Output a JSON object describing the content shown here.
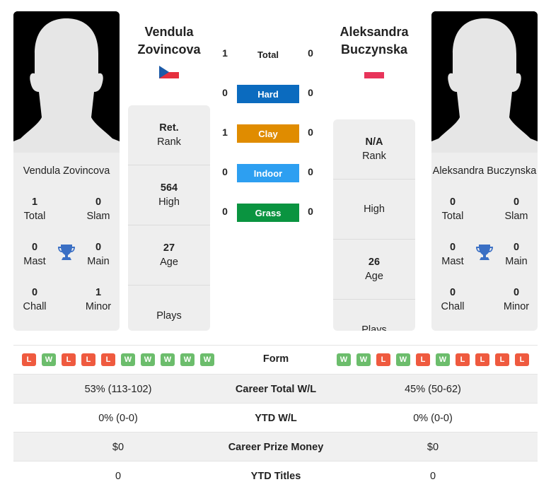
{
  "players": [
    {
      "name_line1": "Vendula",
      "name_line2": "Zovincova",
      "full_name": "Vendula Zovincova",
      "country": "Czech Republic",
      "flag_icon": "czech-flag-icon",
      "titles": {
        "total": {
          "value": "1",
          "label": "Total"
        },
        "slam": {
          "value": "0",
          "label": "Slam"
        },
        "mast": {
          "value": "0",
          "label": "Mast"
        },
        "main": {
          "value": "0",
          "label": "Main"
        },
        "chall": {
          "value": "0",
          "label": "Chall"
        },
        "minor": {
          "value": "1",
          "label": "Minor"
        }
      },
      "stats": {
        "rank": {
          "value": "Ret.",
          "label": "Rank"
        },
        "high": {
          "value": "564",
          "label": "High"
        },
        "age": {
          "value": "27",
          "label": "Age"
        },
        "plays": {
          "value": "",
          "label": "Plays"
        }
      },
      "form": [
        "L",
        "W",
        "L",
        "L",
        "L",
        "W",
        "W",
        "W",
        "W",
        "W"
      ]
    },
    {
      "name_line1": "Aleksandra",
      "name_line2": "Buczynska",
      "full_name": "Aleksandra Buczynska",
      "country": "Poland",
      "flag_icon": "poland-flag-icon",
      "titles": {
        "total": {
          "value": "0",
          "label": "Total"
        },
        "slam": {
          "value": "0",
          "label": "Slam"
        },
        "mast": {
          "value": "0",
          "label": "Mast"
        },
        "main": {
          "value": "0",
          "label": "Main"
        },
        "chall": {
          "value": "0",
          "label": "Chall"
        },
        "minor": {
          "value": "0",
          "label": "Minor"
        }
      },
      "stats": {
        "rank": {
          "value": "N/A",
          "label": "Rank"
        },
        "high": {
          "value": "",
          "label": "High"
        },
        "age": {
          "value": "26",
          "label": "Age"
        },
        "plays": {
          "value": "",
          "label": "Plays"
        }
      },
      "form": [
        "W",
        "W",
        "L",
        "W",
        "L",
        "W",
        "L",
        "L",
        "L",
        "L"
      ]
    }
  ],
  "h2h": [
    {
      "label": "Total",
      "left": "1",
      "right": "0",
      "color": ""
    },
    {
      "label": "Hard",
      "left": "0",
      "right": "0",
      "color": "#0b6bbf"
    },
    {
      "label": "Clay",
      "left": "1",
      "right": "0",
      "color": "#e08c00"
    },
    {
      "label": "Indoor",
      "left": "0",
      "right": "0",
      "color": "#2d9ff1"
    },
    {
      "label": "Grass",
      "left": "0",
      "right": "0",
      "color": "#0a9440"
    }
  ],
  "form_label": "Form",
  "form_colors": {
    "W": "#6cbd6c",
    "L": "#ef5a3f"
  },
  "comparison": [
    {
      "label": "Career Total W/L",
      "left": "53% (113-102)",
      "right": "45% (50-62)"
    },
    {
      "label": "YTD W/L",
      "left": "0% (0-0)",
      "right": "0% (0-0)"
    },
    {
      "label": "Career Prize Money",
      "left": "$0",
      "right": "$0"
    },
    {
      "label": "YTD Titles",
      "left": "0",
      "right": "0"
    }
  ]
}
